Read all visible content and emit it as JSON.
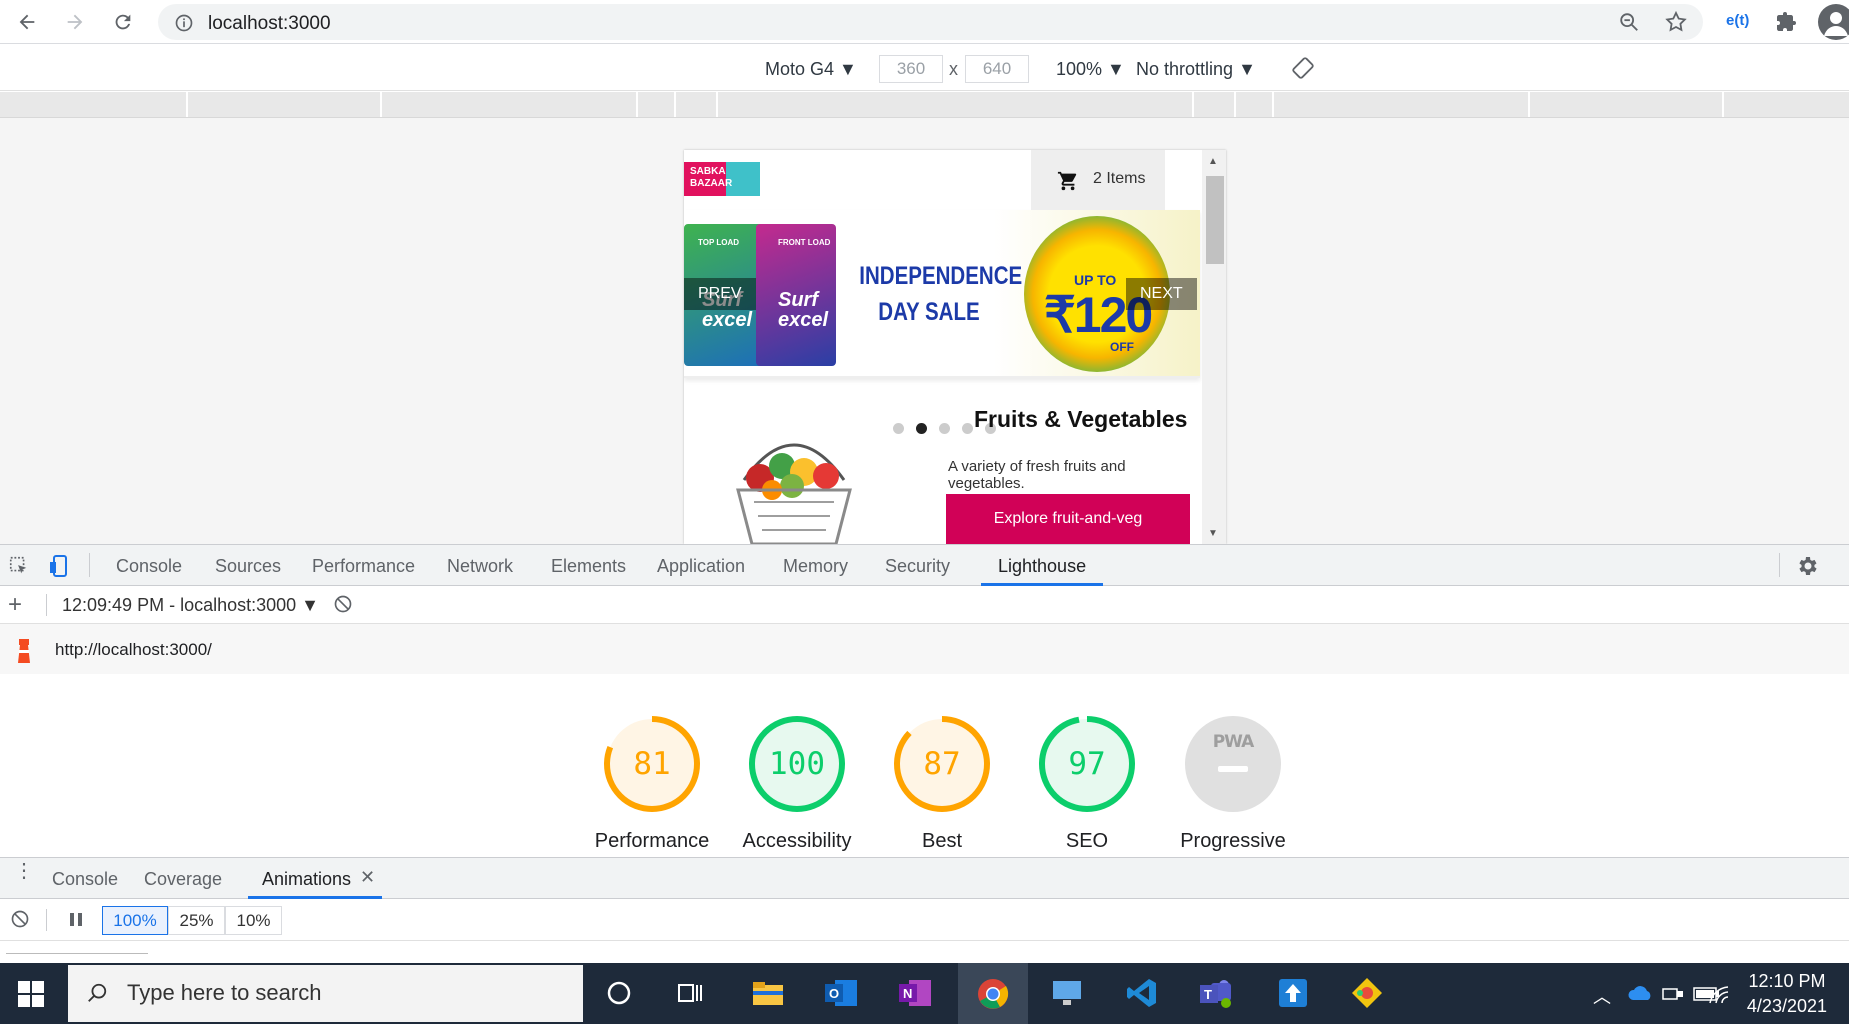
{
  "browser": {
    "url": "localhost:3000"
  },
  "device_toolbar": {
    "device": "Moto G4",
    "width": "360",
    "height": "640",
    "dim_sep": "x",
    "zoom": "100%",
    "throttling": "No throttling"
  },
  "site": {
    "logo_text": "SABKA BAZAAR",
    "cart_label": "2 Items",
    "banner": {
      "prev_label": "PREV",
      "next_label": "NEXT",
      "sale_line1": "INDEPENDENCE",
      "sale_line2": "DAY SALE",
      "offer_upto": "UP TO",
      "offer_amount": "₹120",
      "offer_off": "OFF",
      "pack1_brand": "Surf excel",
      "pack1_tag": "TOP LOAD",
      "pack2_brand": "Surf excel",
      "pack2_tag": "FRONT LOAD",
      "dots_total": 5,
      "active_dot": 2
    },
    "category": {
      "title": "Fruits & Vegetables",
      "description": "A variety of fresh fruits and vegetables.",
      "button": "Explore fruit-and-veg"
    }
  },
  "devtools": {
    "tabs": [
      "Console",
      "Sources",
      "Performance",
      "Network",
      "Elements",
      "Application",
      "Memory",
      "Security",
      "Lighthouse"
    ],
    "active_tab": "Lighthouse",
    "report_selector": "12:09:49 PM - localhost:3000",
    "report_url": "http://localhost:3000/",
    "scores": [
      {
        "label": "Performance",
        "value": "81",
        "score": 0.81,
        "color": "#ffa400"
      },
      {
        "label": "Accessibility",
        "value": "100",
        "score": 1.0,
        "color": "#0cce6b"
      },
      {
        "label": "Best",
        "value": "87",
        "score": 0.87,
        "color": "#ffa400"
      },
      {
        "label": "SEO",
        "value": "97",
        "score": 0.97,
        "color": "#0cce6b"
      },
      {
        "label": "Progressive",
        "value": "PWA",
        "score": 0,
        "color": "#bdbdbd"
      }
    ],
    "drawer_tabs": [
      "Console",
      "Coverage",
      "Animations"
    ],
    "active_drawer_tab": "Animations",
    "animation_speeds": [
      "100%",
      "25%",
      "10%"
    ],
    "active_speed": "100%"
  },
  "taskbar": {
    "search_placeholder": "Type here to search",
    "time": "12:10 PM",
    "date": "4/23/2021"
  },
  "colors": {
    "accent": "#1a73e8",
    "brand_pink": "#d10157",
    "taskbar": "#1e2a3a"
  }
}
